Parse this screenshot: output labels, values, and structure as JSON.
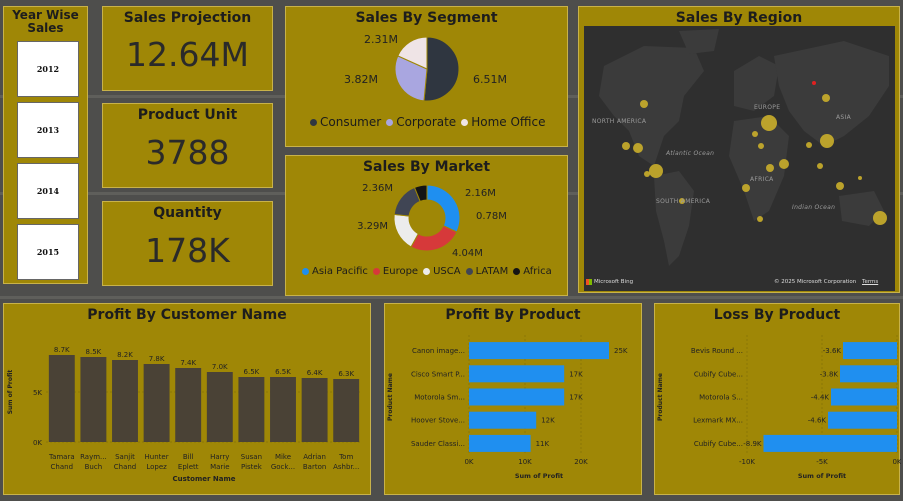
{
  "slicer": {
    "title": "Year Wise Sales",
    "years": [
      "2012",
      "2013",
      "2014",
      "2015"
    ]
  },
  "kpis": {
    "sales_projection": {
      "title": "Sales Projection",
      "value": "12.64M"
    },
    "product_unit": {
      "title": "Product Unit",
      "value": "3788"
    },
    "quantity": {
      "title": "Quantity",
      "value": "178K"
    }
  },
  "sales_by_segment": {
    "title": "Sales By Segment",
    "labels": [
      "6.51M",
      "3.82M",
      "2.31M"
    ],
    "legend": [
      "Consumer",
      "Corporate",
      "Home Office"
    ],
    "colors": [
      "#2f3640",
      "#a9a6e0",
      "#efe4e6"
    ]
  },
  "sales_by_market": {
    "title": "Sales By Market",
    "labels": [
      "4.04M",
      "3.29M",
      "2.36M",
      "2.16M",
      "0.78M"
    ],
    "legend": [
      "Asia Pacific",
      "Europe",
      "USCA",
      "LATAM",
      "Africa"
    ],
    "colors": [
      "#1f8ff0",
      "#d6393a",
      "#ececec",
      "#404554",
      "#141414"
    ]
  },
  "sales_by_region": {
    "title": "Sales By Region",
    "region_labels": [
      "NORTH AMERICA",
      "EUROPE",
      "ASIA",
      "Atlantic Ocean",
      "AFRICA",
      "SOUTH AMERICA",
      "Indian Ocean"
    ],
    "attribution": "Microsoft Bing",
    "copyright": "© 2025 Microsoft Corporation",
    "terms": "Terms"
  },
  "chart_data": [
    {
      "type": "pie",
      "title": "Sales By Segment",
      "categories": [
        "Consumer",
        "Corporate",
        "Home Office"
      ],
      "values": [
        6.51,
        3.82,
        2.31
      ],
      "unit": "M"
    },
    {
      "type": "pie",
      "title": "Sales By Market",
      "categories": [
        "Asia Pacific",
        "Europe",
        "USCA",
        "LATAM",
        "Africa"
      ],
      "values": [
        4.04,
        3.29,
        2.36,
        2.16,
        0.78
      ],
      "unit": "M",
      "donut": true
    },
    {
      "type": "bar",
      "title": "Profit By Customer Name",
      "categories": [
        "Tamara Chand",
        "Raymond Buch",
        "Sanjit Chand",
        "Hunter Lopez",
        "Bill Eplett",
        "Harry Marie",
        "Susan Pistek",
        "Mike Gockenbach",
        "Adrian Barton",
        "Tom Ashbrook"
      ],
      "category_lines": [
        [
          "Tamara",
          "Chand"
        ],
        [
          "Raym...",
          "Buch"
        ],
        [
          "Sanjit",
          "Chand"
        ],
        [
          "Hunter",
          "Lopez"
        ],
        [
          "Bill",
          "Eplett"
        ],
        [
          "Harry",
          "Marie"
        ],
        [
          "Susan",
          "Pistek"
        ],
        [
          "Mike",
          "Gock..."
        ],
        [
          "Adrian",
          "Barton"
        ],
        [
          "Tom",
          "Ashbr..."
        ]
      ],
      "values": [
        8.7,
        8.5,
        8.2,
        7.8,
        7.4,
        7.0,
        6.5,
        6.5,
        6.4,
        6.3
      ],
      "data_labels": [
        "8.7K",
        "8.5K",
        "8.2K",
        "7.8K",
        "7.4K",
        "7.0K",
        "6.5K",
        "6.5K",
        "6.4K",
        "6.3K"
      ],
      "xlabel": "Customer Name",
      "ylabel": "Sum of Profit",
      "ylim": [
        0,
        10
      ],
      "y_ticks": [
        0,
        5
      ],
      "y_tick_labels": [
        "0K",
        "5K"
      ],
      "color": "#4a4236"
    },
    {
      "type": "bar",
      "orientation": "horizontal",
      "title": "Profit By Product",
      "categories": [
        "Canon image...",
        "Cisco Smart P...",
        "Motorola Sm...",
        "Hoover Stove...",
        "Sauder Classi..."
      ],
      "values": [
        25,
        17,
        17,
        12,
        11
      ],
      "data_labels": [
        "25K",
        "17K",
        "17K",
        "12K",
        "11K"
      ],
      "xlabel": "Sum of Profit",
      "ylabel": "Product Name",
      "xlim": [
        0,
        25
      ],
      "x_ticks": [
        0,
        10,
        20
      ],
      "x_tick_labels": [
        "0K",
        "10K",
        "20K"
      ],
      "color": "#1f8ff0"
    },
    {
      "type": "bar",
      "orientation": "horizontal",
      "title": "Loss By Product",
      "categories": [
        "Bevis Round ...",
        "Cubify Cube...",
        "Motorola S...",
        "Lexmark MX...",
        "Cubify Cube..."
      ],
      "values": [
        -3.6,
        -3.8,
        -4.4,
        -4.6,
        -8.9
      ],
      "data_labels": [
        "-3.6K",
        "-3.8K",
        "-4.4K",
        "-4.6K",
        "-8.9K"
      ],
      "xlabel": "Sum of Profit",
      "ylabel": "Product Name",
      "xlim": [
        -10,
        0
      ],
      "x_ticks": [
        -10,
        -5,
        0
      ],
      "x_tick_labels": [
        "-10K",
        "-5K",
        "0K"
      ],
      "color": "#1f8ff0"
    }
  ]
}
